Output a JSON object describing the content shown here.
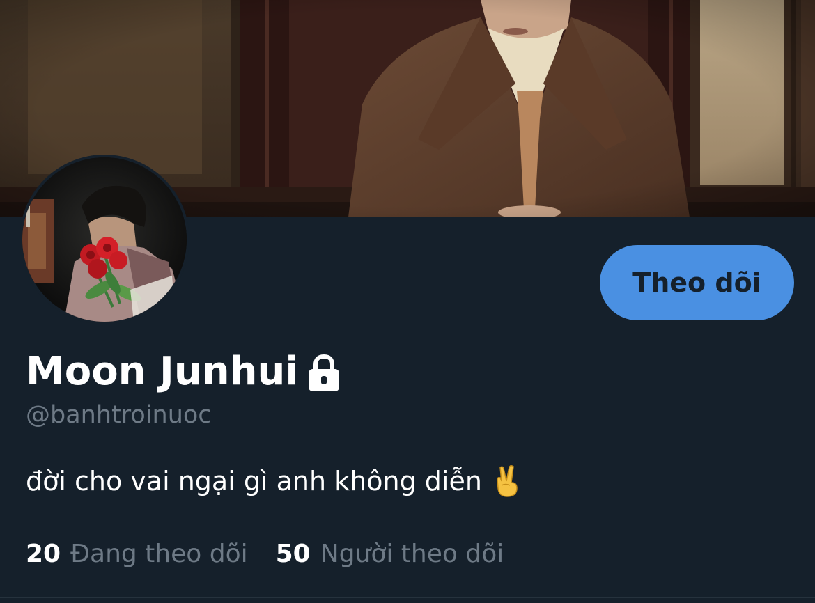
{
  "profile": {
    "display_name": "Moon Junhui",
    "handle": "@banhtroinuoc",
    "bio": "đời cho vai ngại gì anh không diễn",
    "bio_emoji": "victory-hand-icon",
    "protected": true
  },
  "actions": {
    "follow_label": "Theo dõi"
  },
  "stats": {
    "following_count": "20",
    "following_label": "Đang theo dõi",
    "followers_count": "50",
    "followers_label": "Người theo dõi"
  },
  "colors": {
    "background": "#15202b",
    "accent": "#4a90e2",
    "secondary_text": "#6e7a86",
    "primary_text": "#ffffff"
  }
}
